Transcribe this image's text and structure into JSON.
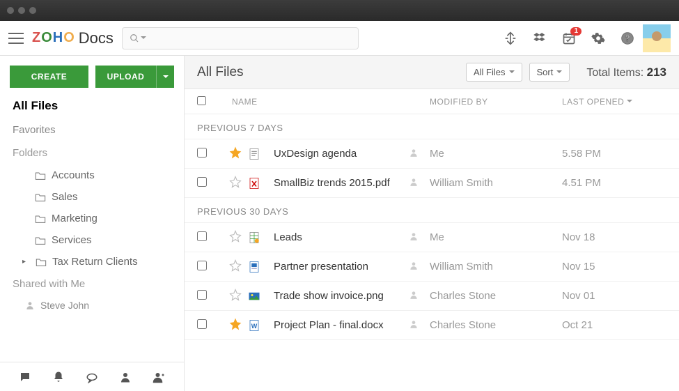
{
  "app": {
    "brand": "ZOHO",
    "product": "Docs"
  },
  "toolbar": {
    "notification_count": "1"
  },
  "sidebar": {
    "create_label": "CREATE",
    "upload_label": "UPLOAD",
    "all_files": "All Files",
    "favorites": "Favorites",
    "folders_label": "Folders",
    "folders": [
      {
        "name": "Accounts"
      },
      {
        "name": "Sales"
      },
      {
        "name": "Marketing"
      },
      {
        "name": "Services"
      },
      {
        "name": "Tax Return Clients",
        "expandable": true
      }
    ],
    "shared_label": "Shared with Me",
    "shared_users": [
      {
        "name": "Steve John"
      }
    ]
  },
  "content": {
    "title": "All Files",
    "filter_label": "All Files",
    "sort_label": "Sort",
    "total_label": "Total Items:",
    "total_count": "213",
    "columns": {
      "name": "NAME",
      "modified": "MODIFIED BY",
      "last": "LAST OPENED"
    },
    "groups": [
      {
        "label": "PREVIOUS 7 DAYS",
        "files": [
          {
            "starred": true,
            "icon": "doc",
            "name": "UxDesign agenda",
            "modified_by": "Me",
            "last_opened": "5.58 PM"
          },
          {
            "starred": false,
            "icon": "pdf",
            "name": "SmallBiz trends 2015.pdf",
            "modified_by": "William Smith",
            "last_opened": "4.51 PM"
          }
        ]
      },
      {
        "label": "PREVIOUS 30 DAYS",
        "files": [
          {
            "starred": false,
            "icon": "sheet",
            "name": "Leads",
            "modified_by": "Me",
            "last_opened": "Nov 18"
          },
          {
            "starred": false,
            "icon": "pres",
            "name": "Partner presentation",
            "modified_by": "William Smith",
            "last_opened": "Nov 15"
          },
          {
            "starred": false,
            "icon": "img",
            "name": "Trade show invoice.png",
            "modified_by": "Charles Stone",
            "last_opened": "Nov 01"
          },
          {
            "starred": true,
            "icon": "word",
            "name": "Project Plan - final.docx",
            "modified_by": "Charles Stone",
            "last_opened": "Oct 21"
          }
        ]
      }
    ]
  }
}
